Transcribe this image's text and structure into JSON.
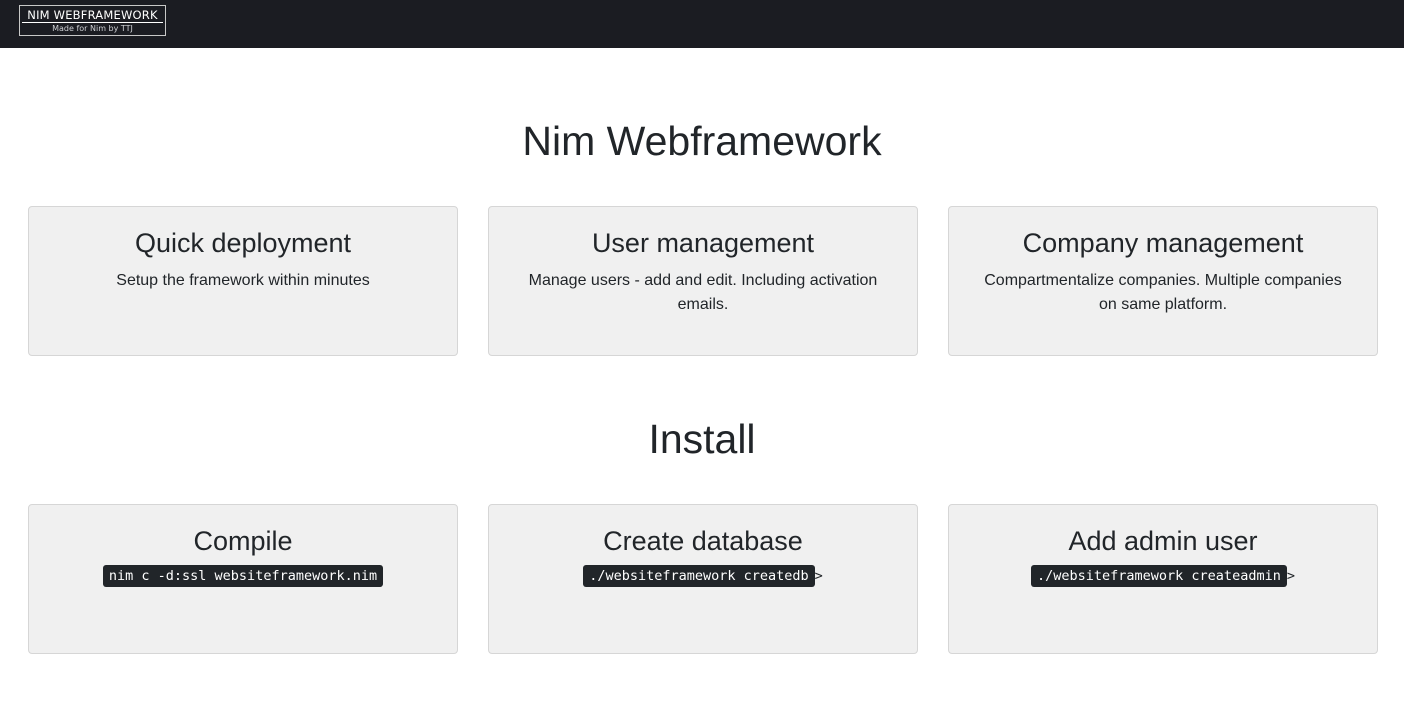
{
  "navbar": {
    "brand_name": "NIM WEBFRAMEWORK",
    "brand_tagline": "Made for Nim by TTJ"
  },
  "features": {
    "title": "Nim Webframework",
    "cards": [
      {
        "title": "Quick deployment",
        "text": "Setup the framework within minutes"
      },
      {
        "title": "User management",
        "text": "Manage users - add and edit. Including activation emails."
      },
      {
        "title": "Company management",
        "text": "Compartmentalize companies. Multiple companies on same platform."
      }
    ]
  },
  "install": {
    "title": "Install",
    "cards": [
      {
        "title": "Compile",
        "command": "nim c -d:ssl websiteframework.nim",
        "suffix": ""
      },
      {
        "title": "Create database",
        "command": "./websiteframework createdb",
        "suffix": ">"
      },
      {
        "title": "Add admin user",
        "command": "./websiteframework createadmin",
        "suffix": ">"
      }
    ]
  },
  "colors": {
    "navbar_bg": "#1b1c22",
    "card_bg": "#f0f0f0",
    "code_bg": "#212529"
  }
}
